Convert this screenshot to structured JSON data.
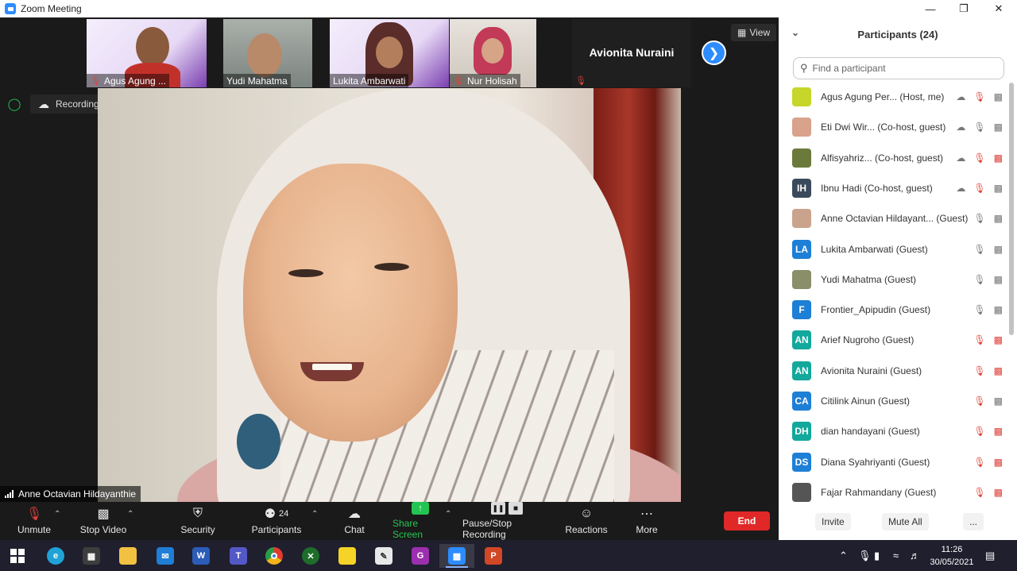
{
  "window": {
    "title": "Zoom Meeting",
    "controls": [
      "minimize",
      "restore",
      "close"
    ]
  },
  "video_strip": {
    "tiles": [
      {
        "name": "Agus Agung ...",
        "muted": true
      },
      {
        "name": "Yudi Mahatma",
        "muted": false
      },
      {
        "name": "Lukita Ambarwati",
        "muted": false
      },
      {
        "name": "Nur Holisah",
        "muted": true
      },
      {
        "name": "Avionita Nuraini",
        "muted": true
      }
    ],
    "view_label": "View"
  },
  "recording": {
    "label": "Recording..."
  },
  "main_video": {
    "speaker_name": "Anne Octavian Hildayanthie"
  },
  "toolbar": {
    "unmute": "Unmute",
    "stop_video": "Stop Video",
    "security": "Security",
    "participants": "Participants",
    "participants_count": "24",
    "chat": "Chat",
    "share_screen": "Share Screen",
    "pause_stop_recording": "Pause/Stop Recording",
    "reactions": "Reactions",
    "more": "More",
    "end": "End"
  },
  "panel": {
    "title": "Participants (24)",
    "search_placeholder": "Find a participant",
    "participants": [
      {
        "name": "Agus Agung Per...  (Host, me)",
        "avatar": "",
        "color": "#c6d62b",
        "mic_muted": true,
        "cam_off": false,
        "rec": true
      },
      {
        "name": "Eti Dwi Wir...  (Co-host, guest)",
        "avatar": "",
        "color": "#d8a28b",
        "mic_muted": false,
        "cam_off": false,
        "rec": true
      },
      {
        "name": "Alfisyahriz...  (Co-host, guest)",
        "avatar": "",
        "color": "#6b7a3a",
        "mic_muted": true,
        "cam_off": true,
        "rec": true
      },
      {
        "name": "Ibnu Hadi (Co-host, guest)",
        "avatar": "IH",
        "color": "#3a4a5c",
        "mic_muted": true,
        "cam_off": false,
        "rec": true
      },
      {
        "name": "Anne Octavian Hildayant... (Guest)",
        "avatar": "",
        "color": "#c9a38b",
        "mic_muted": false,
        "cam_off": false,
        "rec": false
      },
      {
        "name": "Lukita Ambarwati (Guest)",
        "avatar": "LA",
        "color": "#1e7fd6",
        "mic_muted": false,
        "cam_off": false,
        "rec": false
      },
      {
        "name": "Yudi Mahatma (Guest)",
        "avatar": "",
        "color": "#8a8f6a",
        "mic_muted": false,
        "cam_off": false,
        "rec": false
      },
      {
        "name": "Frontier_Apipudin (Guest)",
        "avatar": "F",
        "color": "#1e7fd6",
        "mic_muted": false,
        "cam_off": false,
        "rec": false
      },
      {
        "name": "Arief Nugroho (Guest)",
        "avatar": "AN",
        "color": "#12a89c",
        "mic_muted": true,
        "cam_off": true,
        "rec": false
      },
      {
        "name": "Avionita Nuraini (Guest)",
        "avatar": "AN",
        "color": "#12a89c",
        "mic_muted": true,
        "cam_off": true,
        "rec": false
      },
      {
        "name": "Citilink Ainun (Guest)",
        "avatar": "CA",
        "color": "#1e7fd6",
        "mic_muted": true,
        "cam_off": false,
        "rec": false
      },
      {
        "name": "dian handayani (Guest)",
        "avatar": "DH",
        "color": "#12a89c",
        "mic_muted": true,
        "cam_off": true,
        "rec": false
      },
      {
        "name": "Diana Syahriyanti (Guest)",
        "avatar": "DS",
        "color": "#1e7fd6",
        "mic_muted": true,
        "cam_off": true,
        "rec": false
      },
      {
        "name": "Fajar Rahmandany (Guest)",
        "avatar": "",
        "color": "#555555",
        "mic_muted": true,
        "cam_off": true,
        "rec": false
      }
    ],
    "invite": "Invite",
    "mute_all": "Mute All",
    "more": "..."
  },
  "taskbar": {
    "time": "11:26",
    "date": "30/05/2021"
  }
}
